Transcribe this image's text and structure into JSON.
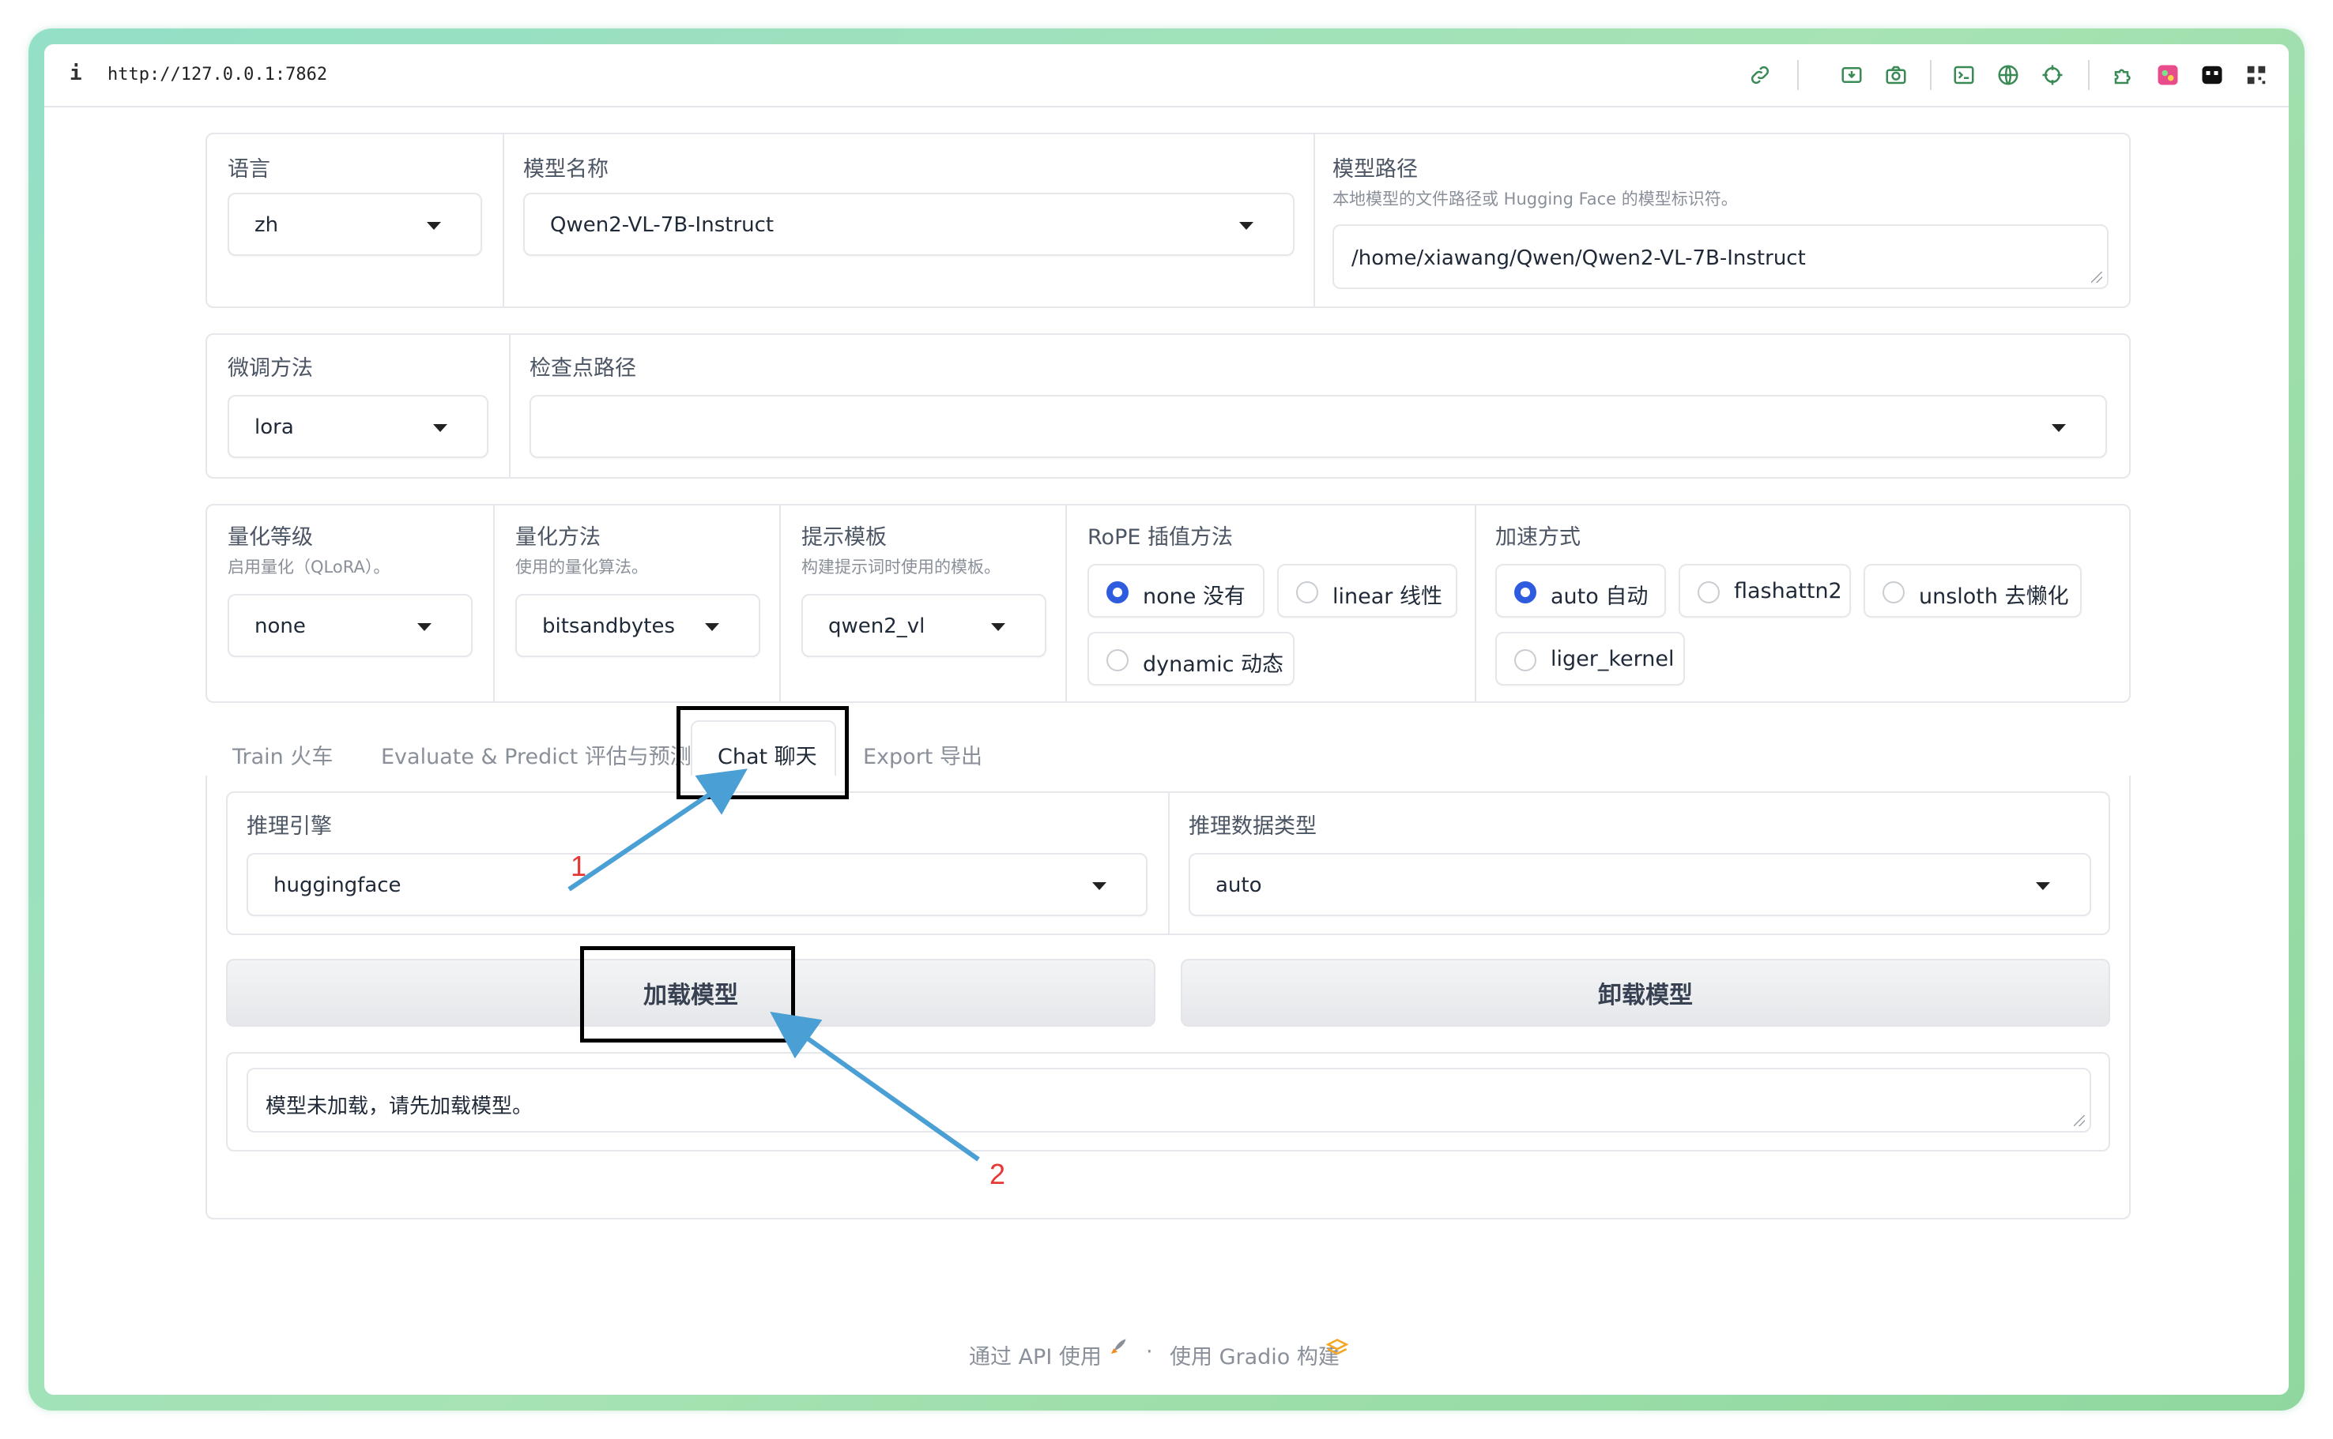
{
  "browser": {
    "info_glyph": "i",
    "url": "http://127.0.0.1:7862"
  },
  "model_row": {
    "language": {
      "label": "语言",
      "value": "zh"
    },
    "model_name": {
      "label": "模型名称",
      "value": "Qwen2-VL-7B-Instruct"
    },
    "model_path": {
      "label": "模型路径",
      "sublabel": "本地模型的文件路径或 Hugging Face 的模型标识符。",
      "value": "/home/xiawang/Qwen/Qwen2-VL-7B-Instruct"
    }
  },
  "finetune_row": {
    "method": {
      "label": "微调方法",
      "value": "lora"
    },
    "checkpoint": {
      "label": "检查点路径",
      "value": ""
    }
  },
  "advanced_row": {
    "quant_bit": {
      "label": "量化等级",
      "sublabel": "启用量化（QLoRA）。",
      "value": "none"
    },
    "quant_method": {
      "label": "量化方法",
      "sublabel": "使用的量化算法。",
      "value": "bitsandbytes"
    },
    "template": {
      "label": "提示模板",
      "sublabel": "构建提示词时使用的模板。",
      "value": "qwen2_vl"
    },
    "rope": {
      "label": "RoPE 插值方法",
      "options": [
        "none 没有",
        "linear 线性",
        "dynamic 动态"
      ],
      "selected": "none 没有"
    },
    "booster": {
      "label": "加速方式",
      "options": [
        "auto 自动",
        "flashattn2",
        "unsloth 去懒化",
        "liger_kernel"
      ],
      "selected": "auto 自动"
    }
  },
  "tabs": [
    "Train 火车",
    "Evaluate & Predict 评估与预测",
    "Chat 聊天",
    "Export 导出"
  ],
  "active_tab": "Chat 聊天",
  "chat": {
    "infer_backend": {
      "label": "推理引擎",
      "value": "huggingface"
    },
    "infer_dtype": {
      "label": "推理数据类型",
      "value": "auto"
    },
    "load_button": "加载模型",
    "unload_button": "卸载模型",
    "info_box": "模型未加载，请先加载模型。"
  },
  "annotations": [
    "1",
    "2"
  ],
  "annotation_color": "#e53935",
  "arrow_color": "#4a9fd4",
  "footer": {
    "api": "通过 API 使用",
    "separator": "·",
    "built": "使用 Gradio 构建"
  }
}
